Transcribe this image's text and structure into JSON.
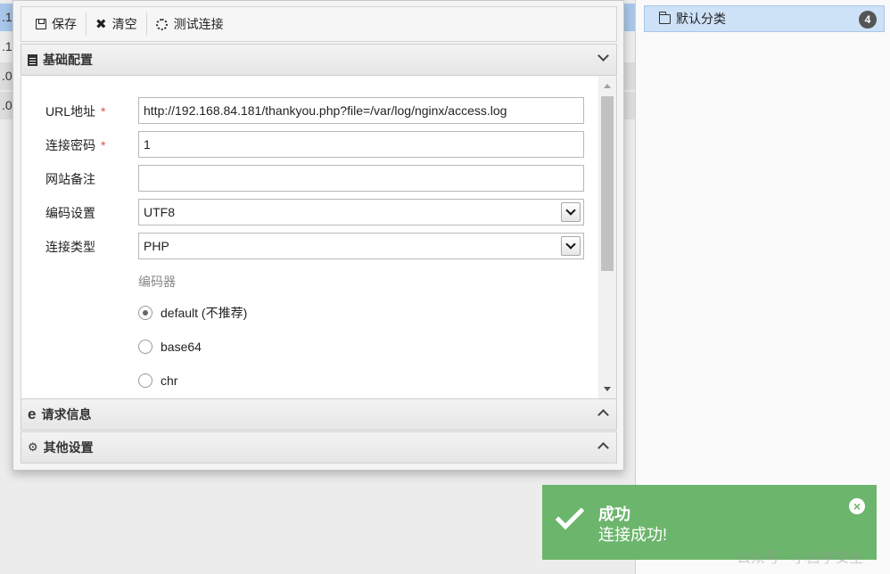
{
  "background_rows": [
    ".1",
    ".1",
    ".0",
    ".0"
  ],
  "category": {
    "label": "默认分类",
    "count": "4"
  },
  "toolbar": {
    "save": "保存",
    "clear": "清空",
    "test": "测试连接"
  },
  "sections": {
    "basic": "基础配置",
    "request": "请求信息",
    "other": "其他设置"
  },
  "form": {
    "url_label": "URL地址",
    "url_value": "http://192.168.84.181/thankyou.php?file=/var/log/nginx/access.log",
    "password_label": "连接密码",
    "password_value": "1",
    "note_label": "网站备注",
    "note_value": "",
    "encoding_label": "编码设置",
    "encoding_value": "UTF8",
    "type_label": "连接类型",
    "type_value": "PHP",
    "encoder_label": "编码器",
    "required_mark": "*",
    "encoders": [
      {
        "label": "default (不推荐)",
        "checked": true
      },
      {
        "label": "base64",
        "checked": false
      },
      {
        "label": "chr",
        "checked": false
      }
    ]
  },
  "toast": {
    "title": "成功",
    "message": "连接成功!",
    "close": "×"
  },
  "watermark": "公众号 · 小白学安全"
}
